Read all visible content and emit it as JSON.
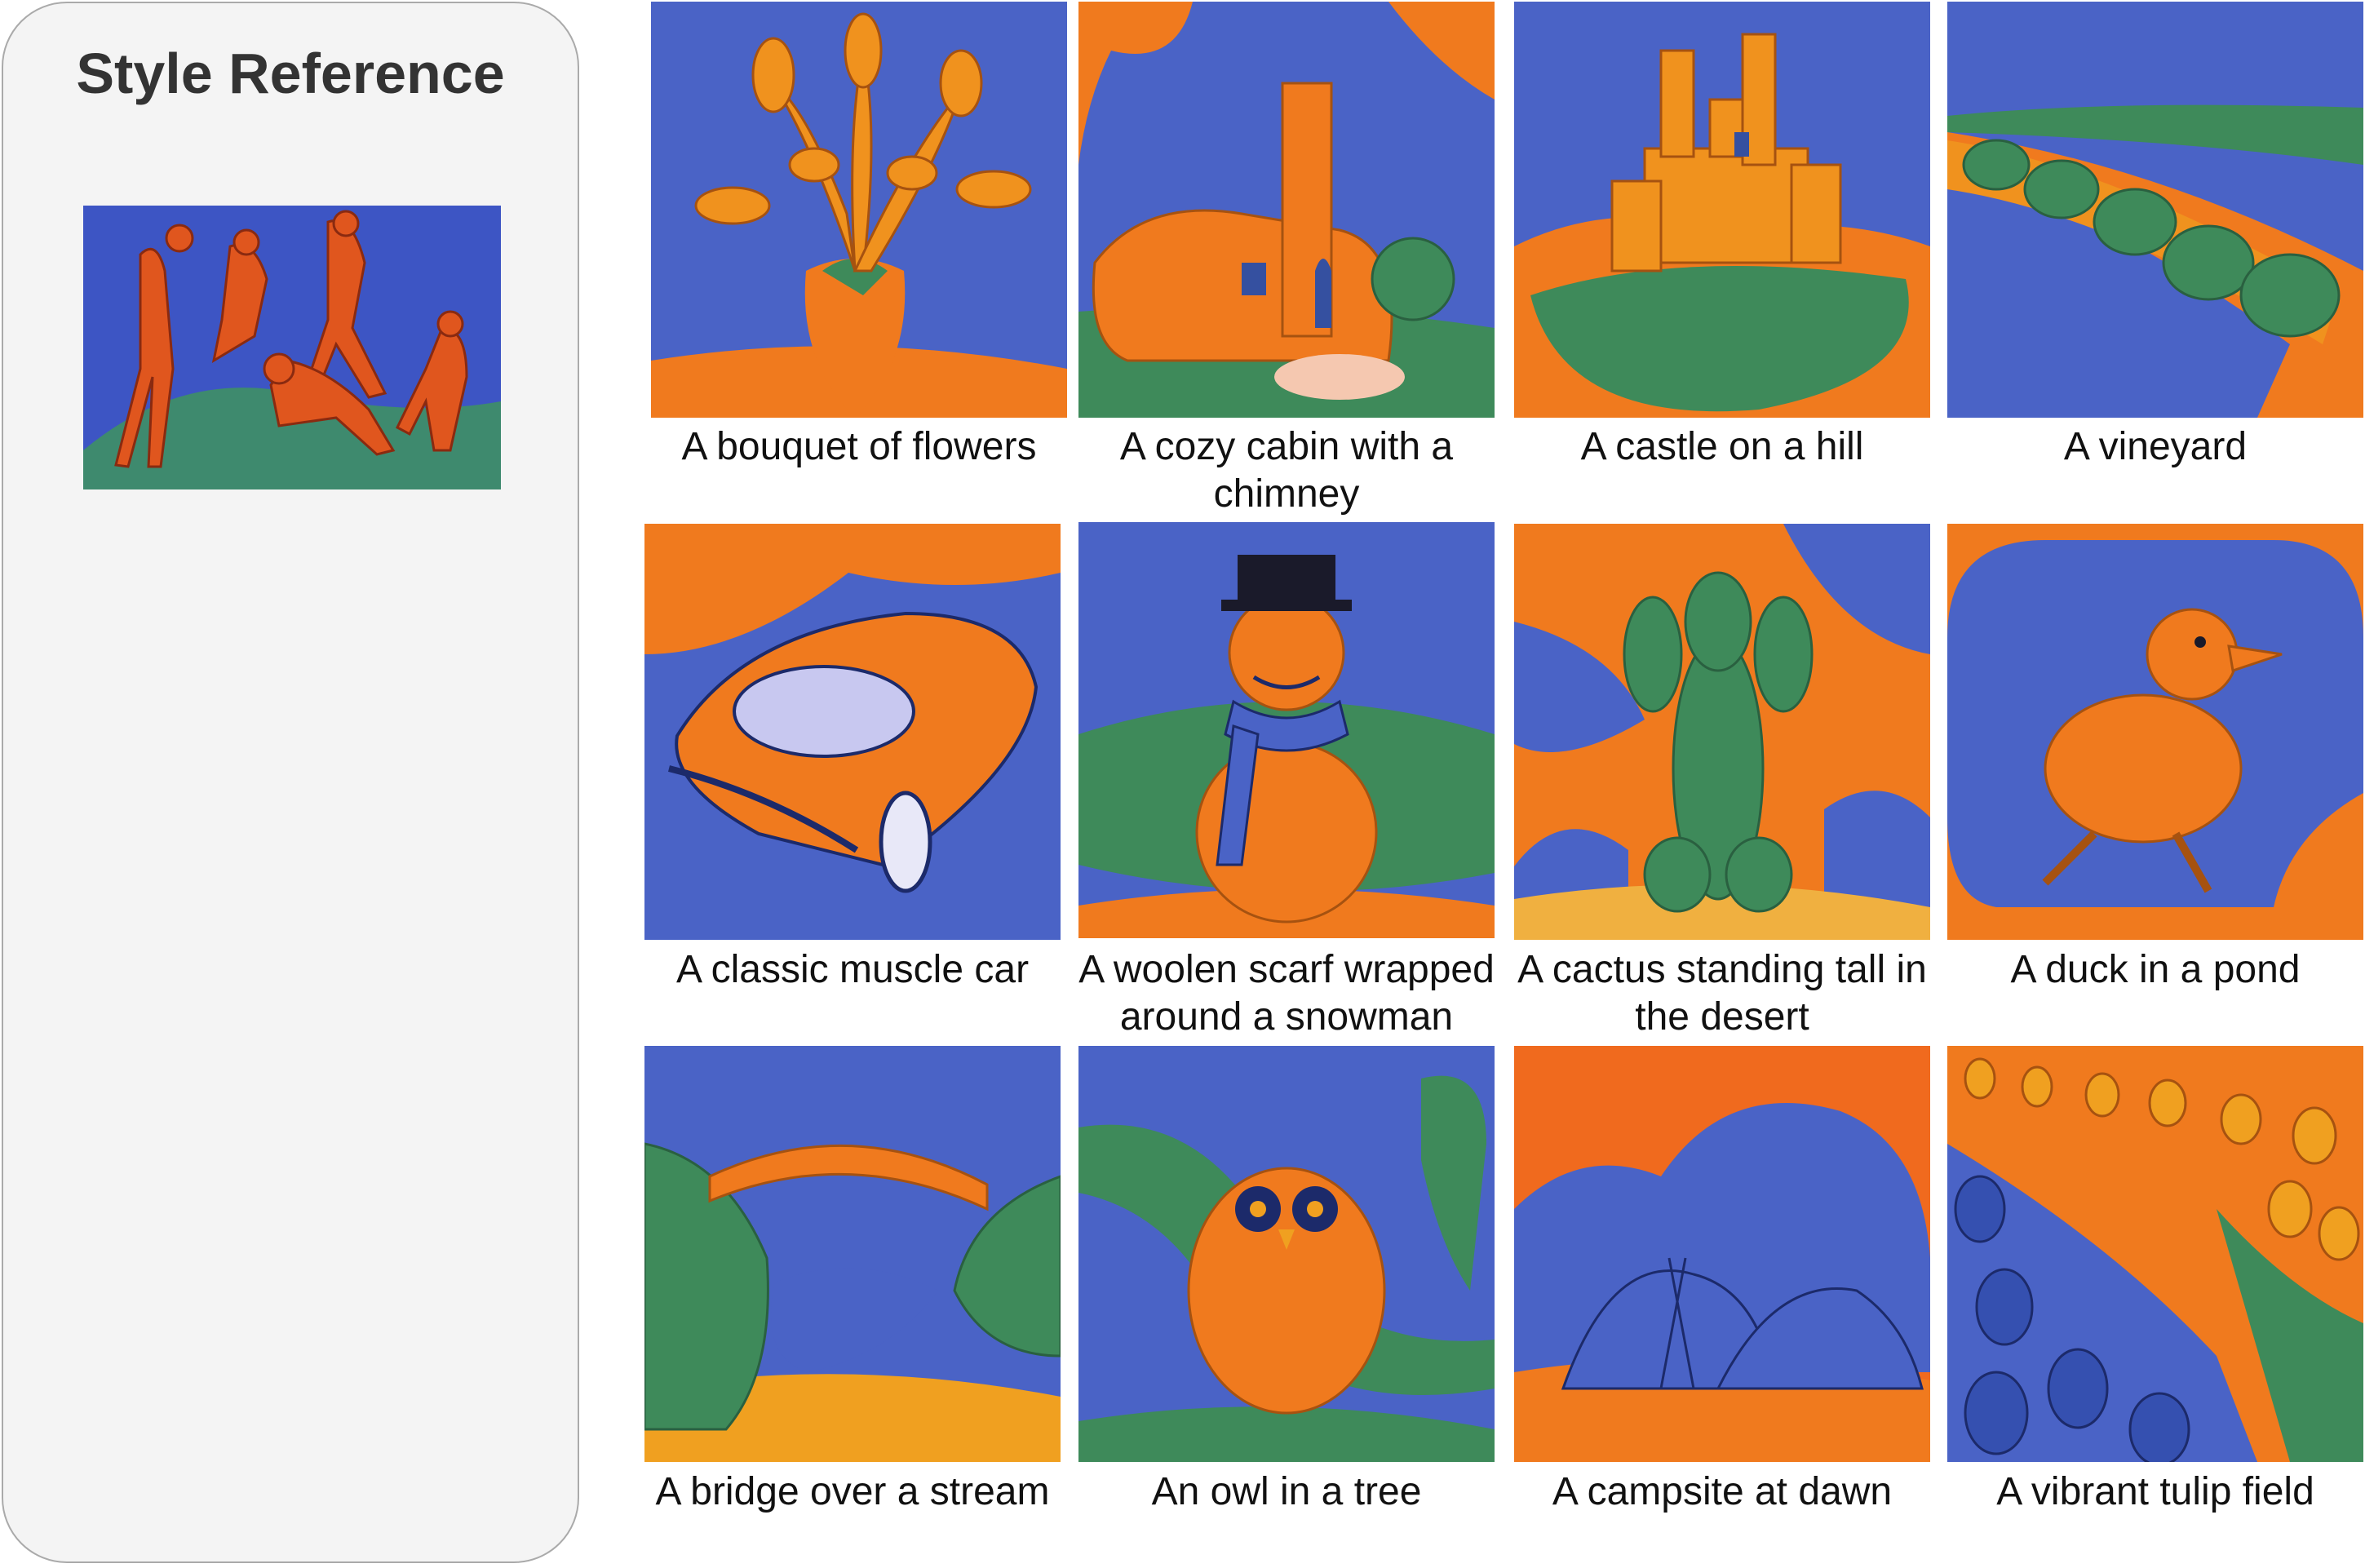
{
  "style_reference": {
    "title": "Style Reference",
    "image": {
      "icon": "dance-painting-image"
    }
  },
  "gallery": [
    {
      "caption": "A bouquet of flowers",
      "icon": "bouquet-image"
    },
    {
      "caption": "A cozy cabin with a chimney",
      "icon": "cabin-image"
    },
    {
      "caption": "A castle on a hill",
      "icon": "castle-image"
    },
    {
      "caption": "A vineyard",
      "icon": "vineyard-image"
    },
    {
      "caption": "A classic muscle car",
      "icon": "muscle-car-image"
    },
    {
      "caption": "A woolen scarf wrapped around a snowman",
      "icon": "snowman-image"
    },
    {
      "caption": "A cactus standing tall in the desert",
      "icon": "cactus-image"
    },
    {
      "caption": "A duck in a pond",
      "icon": "duck-image"
    },
    {
      "caption": "A bridge over a stream",
      "icon": "bridge-image"
    },
    {
      "caption": "An owl in a tree",
      "icon": "owl-image"
    },
    {
      "caption": "A campsite at dawn",
      "icon": "campsite-image"
    },
    {
      "caption": "A vibrant tulip field",
      "icon": "tulip-field-image"
    }
  ],
  "palette": {
    "blue": "#4a63c6",
    "orange": "#f07a1e",
    "green": "#3e8a5a",
    "panel": "#f4f4f4"
  }
}
